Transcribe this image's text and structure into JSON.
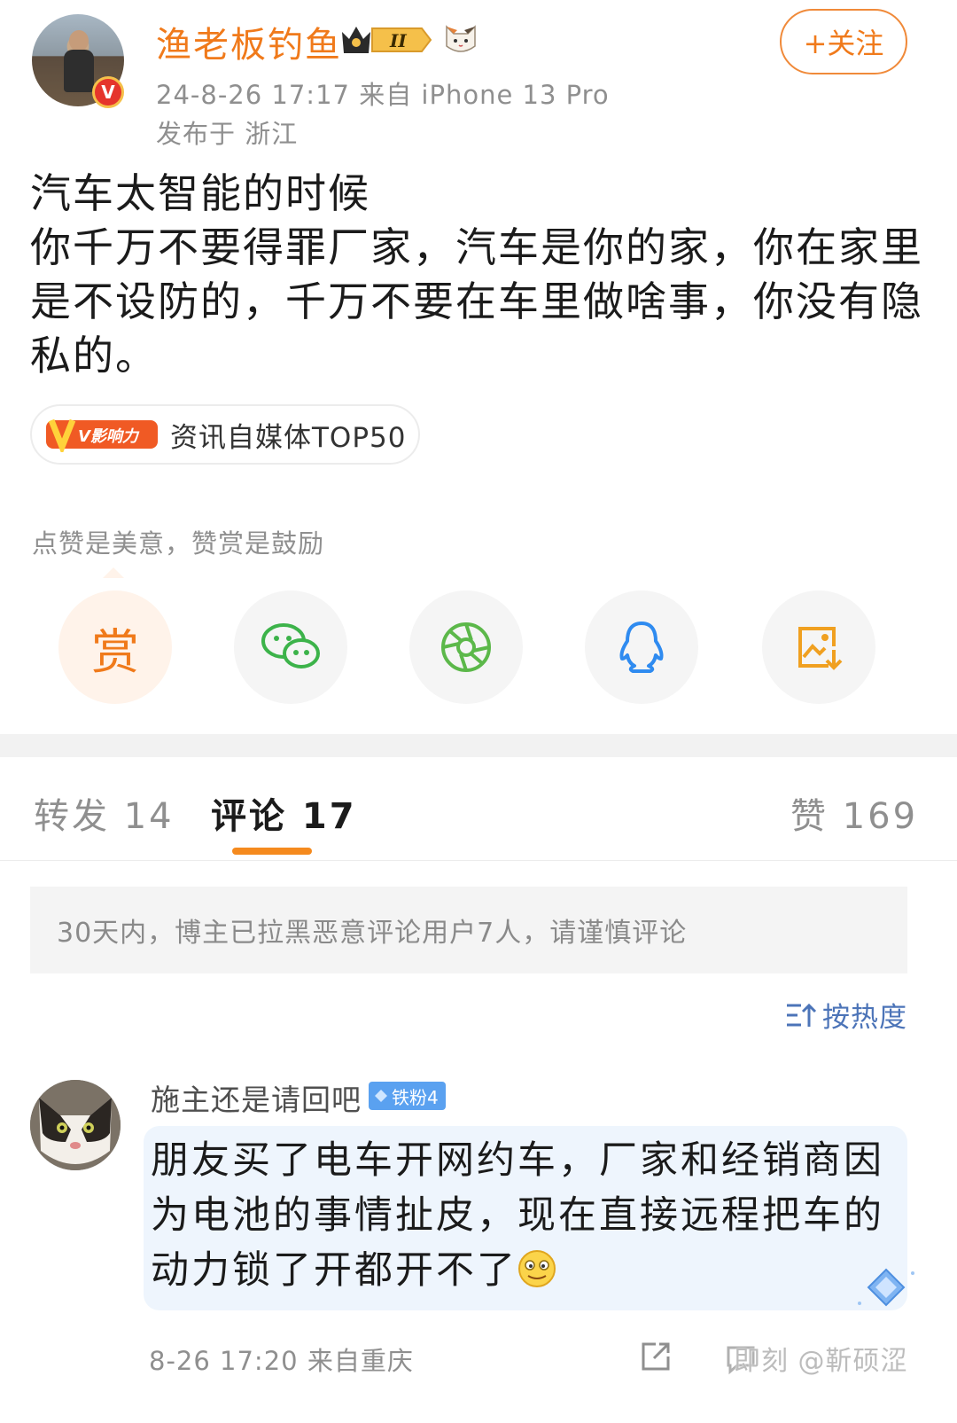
{
  "post": {
    "author": "渔老板钓鱼",
    "verified_badge": "V",
    "level_badge": "II",
    "time_device": "24-8-26 17:17  来自 iPhone 13 Pro",
    "location": "发布于 浙江",
    "follow_label": "+关注",
    "text_lines": [
      "汽车太智能的时候",
      "你千万不要得罪厂家，汽车是你的家，你在家里",
      "是不设防的，千万不要在车里做啥事，你没有隐",
      "私的。"
    ],
    "tag": {
      "logo_text": "V影响力",
      "label": "资讯自媒体TOP50"
    }
  },
  "reward": {
    "prompt": "点赞是美意，赞赏是鼓励",
    "reward_label": "赏",
    "share_targets": [
      "wechat-icon",
      "moments-icon",
      "qq-icon",
      "save-image-icon"
    ]
  },
  "tabs": {
    "repost": "转发 14",
    "comments": "评论 17",
    "likes": "赞 169"
  },
  "notice": "30天内，博主已拉黑恶意评论用户7人，请谨慎评论",
  "sort_label": "按热度",
  "comment": {
    "name": "施主还是请回吧",
    "fan_badge": "铁粉4",
    "lines": [
      "朋友买了电车开网约车，厂家和经销商因",
      "为电池的事情扯皮，现在直接远程把车的",
      "动力锁了开都开不了"
    ],
    "time_location": "8-26 17:20 来自重庆"
  },
  "watermark": "即刻 @靳硕涩",
  "colors": {
    "accent": "#f07a1b",
    "link_blue": "#4c74b8",
    "meta_gray": "#8f8f8f"
  }
}
